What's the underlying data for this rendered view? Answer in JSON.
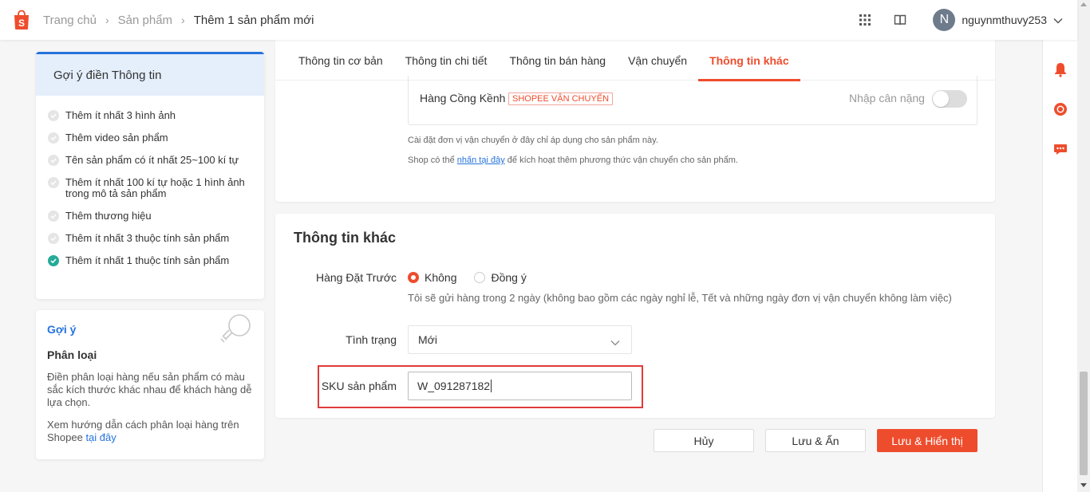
{
  "header": {
    "breadcrumbs": [
      "Trang chủ",
      "Sản phẩm",
      "Thêm 1 sản phẩm mới"
    ],
    "avatar_initial": "N",
    "username": "nguynmthuvy253",
    "brand_color": "#ee4d2d"
  },
  "suggestions": {
    "title": "Gợi ý điền Thông tin",
    "items": [
      {
        "label": "Thêm ít nhất 3 hình ảnh",
        "done": false
      },
      {
        "label": "Thêm video sản phẩm",
        "done": false
      },
      {
        "label": "Tên sản phẩm có ít nhất 25~100 kí tự",
        "done": false
      },
      {
        "label": "Thêm ít nhất 100 kí tự hoặc 1 hình ảnh trong mô tả sản phẩm",
        "done": false
      },
      {
        "label": "Thêm thương hiệu",
        "done": false
      },
      {
        "label": "Thêm ít nhất 3 thuộc tính sản phẩm",
        "done": false
      },
      {
        "label": "Thêm ít nhất 1 thuộc tính sản phẩm",
        "done": true
      }
    ]
  },
  "tip": {
    "title": "Gợi ý",
    "subtitle": "Phân loại",
    "text": "Điền phân loại hàng nếu sản phẩm có màu sắc kích thước khác nhau để khách hàng dễ lựa chọn.",
    "guide_text": "Xem hướng dẫn cách phân loại hàng trên Shopee ",
    "guide_link": "tại đây"
  },
  "tabs": [
    {
      "label": "Thông tin cơ bản",
      "active": false
    },
    {
      "label": "Thông tin chi tiết",
      "active": false
    },
    {
      "label": "Thông tin bán hàng",
      "active": false
    },
    {
      "label": "Vận chuyển",
      "active": false
    },
    {
      "label": "Thông tin khác",
      "active": true
    }
  ],
  "shipping": {
    "method_name": "Hàng Cồng Kềnh",
    "badge": "SHOPEE VẬN CHUYỂN",
    "weight_placeholder": "Nhập cân nặng",
    "note1": "Cài đặt đơn vị vận chuyển ở đây chỉ áp dụng cho sản phẩm này.",
    "note2_before": "Shop có thể ",
    "note2_link": "nhấn tại đây",
    "note2_after": " để kích hoạt thêm phương thức vận chuyển cho sản phẩm."
  },
  "other_info": {
    "title": "Thông tin khác",
    "preorder_label": "Hàng Đặt Trước",
    "preorder_options": [
      "Không",
      "Đồng ý"
    ],
    "preorder_selected": "Không",
    "preorder_note": "Tôi sẽ gửi hàng trong 2 ngày (không bao gồm các ngày nghỉ lễ, Tết và những ngày đơn vị vận chuyển không làm việc)",
    "condition_label": "Tình trạng",
    "condition_value": "Mới",
    "sku_label": "SKU sản phẩm",
    "sku_value": "W_091287182"
  },
  "actions": {
    "cancel": "Hủy",
    "save_hide": "Lưu & Ẩn",
    "save_show": "Lưu & Hiển thị"
  }
}
